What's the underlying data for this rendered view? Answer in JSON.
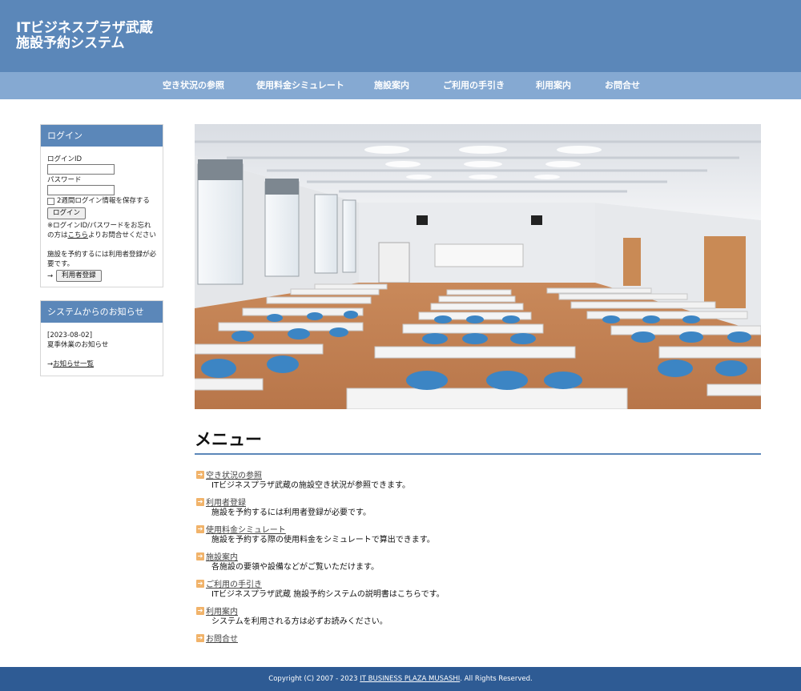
{
  "header": {
    "title_line1": "ITビジネスプラザ武蔵",
    "title_line2": "施設予約システム"
  },
  "nav": [
    "空き状況の参照",
    "使用料金シミュレート",
    "施設案内",
    "ご利用の手引き",
    "利用案内",
    "お問合せ"
  ],
  "login": {
    "title": "ログイン",
    "id_label": "ログインID",
    "password_label": "パスワード",
    "remember_label": "2週間ログイン情報を保存する",
    "login_button": "ログイン",
    "forgot_prefix": "※ログインID/パスワードをお忘れの方は",
    "forgot_link": "こちら",
    "forgot_suffix": "よりお問合せください",
    "register_note": "施設を予約するには利用者登録が必要です。",
    "register_arrow": "→",
    "register_button": "利用者登録"
  },
  "notices": {
    "title": "システムからのお知らせ",
    "items": [
      {
        "date": "[2023-08-02]",
        "text": "夏季休業のお知らせ"
      }
    ],
    "list_prefix": "→",
    "list_link": "お知らせ一覧"
  },
  "menu": {
    "heading": "メニュー",
    "items": [
      {
        "label": "空き状況の参照",
        "desc": "ITビジネスプラザ武蔵の施設空き状況が参照できます。"
      },
      {
        "label": "利用者登録",
        "desc": "施設を予約するには利用者登録が必要です。"
      },
      {
        "label": "使用料金シミュレート",
        "desc": "施設を予約する際の使用料金をシミュレートで算出できます。"
      },
      {
        "label": "施設案内",
        "desc": "各施設の要領や設備などがご覧いただけます。"
      },
      {
        "label": "ご利用の手引き",
        "desc": "ITビジネスプラザ武蔵 施設予約システムの説明書はこちらです。"
      },
      {
        "label": "利用案内",
        "desc": "システムを利用される方は必ずお読みください。"
      },
      {
        "label": "お問合せ",
        "desc": ""
      }
    ]
  },
  "footer": {
    "prefix": "Copyright (C) 2007 - 2023 ",
    "link": "IT BUSINESS PLAZA MUSASHI",
    "suffix": ". All Rights Reserved."
  },
  "colors": {
    "header": "#5b87b9",
    "nav": "#85a9d2",
    "footer": "#2e5b94",
    "accent": "#f1b36a"
  }
}
